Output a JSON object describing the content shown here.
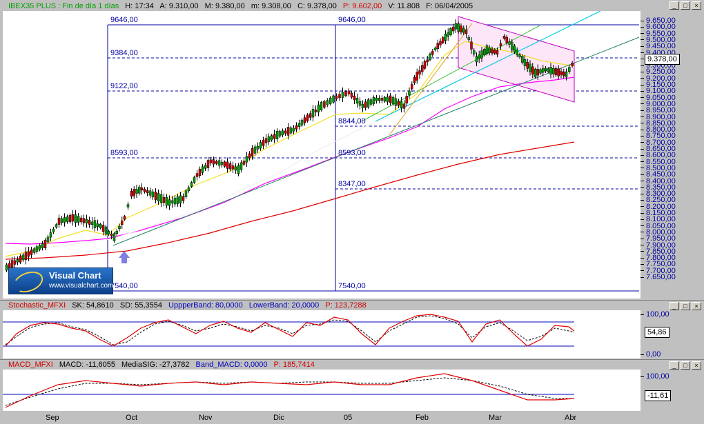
{
  "main": {
    "header": {
      "symbol": "IBEX35 PLUS : Fin de día 1 días",
      "hour_label": "H: 17:34",
      "open_label": "A: 9.310,00",
      "max_label": "M: 9.380,00",
      "min_label": "m: 9.308,00",
      "close_label": "C: 9.378,00",
      "prev_label": "P: 9.602,00",
      "vol_label": "V: 11.808",
      "date_label": "F: 06/04/2005"
    },
    "fib_labels": {
      "left_top": "9646,00",
      "left_9384": "9384,00",
      "left_9122": "9122,00",
      "left_8593": "8593,00",
      "left_bottom": "7540,00",
      "right_top": "9646,00",
      "right_8844": "8844,00",
      "right_8593": "8593,00",
      "right_8347": "8347,00",
      "right_bottom": "7540,00"
    },
    "price_ticks": [
      "9.650,00",
      "9.600,00",
      "9.550,00",
      "9.500,00",
      "9.450,00",
      "9.400,00",
      "9.350,00",
      "9.300,00",
      "9.250,00",
      "9.200,00",
      "9.150,00",
      "9.100,00",
      "9.050,00",
      "9.000,00",
      "8.950,00",
      "8.900,00",
      "8.850,00",
      "8.800,00",
      "8.750,00",
      "8.700,00",
      "8.650,00",
      "8.600,00",
      "8.550,00",
      "8.500,00",
      "8.450,00",
      "8.400,00",
      "8.350,00",
      "8.300,00",
      "8.250,00",
      "8.200,00",
      "8.150,00",
      "8.100,00",
      "8.050,00",
      "8.000,00",
      "7.950,00",
      "7.900,00",
      "7.850,00",
      "7.800,00",
      "7.750,00",
      "7.700,00",
      "7.650,00"
    ],
    "last_price": "9.378,00",
    "logo_title": "Visual Chart",
    "logo_url": "www.visualchart.com"
  },
  "stoch": {
    "name": "Stochastic_MFXI",
    "sk": "SK: 54,8610",
    "sd": "SD: 55,3554",
    "upper": "UppperBand: 80,0000",
    "lower": "LowerBand: 20,0000",
    "p": "P: 123,7288",
    "tick_top": "100,00",
    "tick_bottom": "0,00",
    "last": "54,86"
  },
  "macd": {
    "name": "MACD_MFXI",
    "macd": "MACD: -11,6055",
    "media": "MediaSIG: -27,3782",
    "band": "Band_MACD: 0,0000",
    "p": "P: 185,7414",
    "tick_top": "100,00",
    "last": "-11,61"
  },
  "xaxis": [
    "Sep",
    "Oct",
    "Nov",
    "Dic",
    "05",
    "Feb",
    "Mar",
    "Abr"
  ],
  "colors": {
    "candle_up": "#00a000",
    "candle_down": "#d00000",
    "grid": "#0000a0",
    "ma_long": "#e00000",
    "ma_mid": "#ff00ff"
  }
}
